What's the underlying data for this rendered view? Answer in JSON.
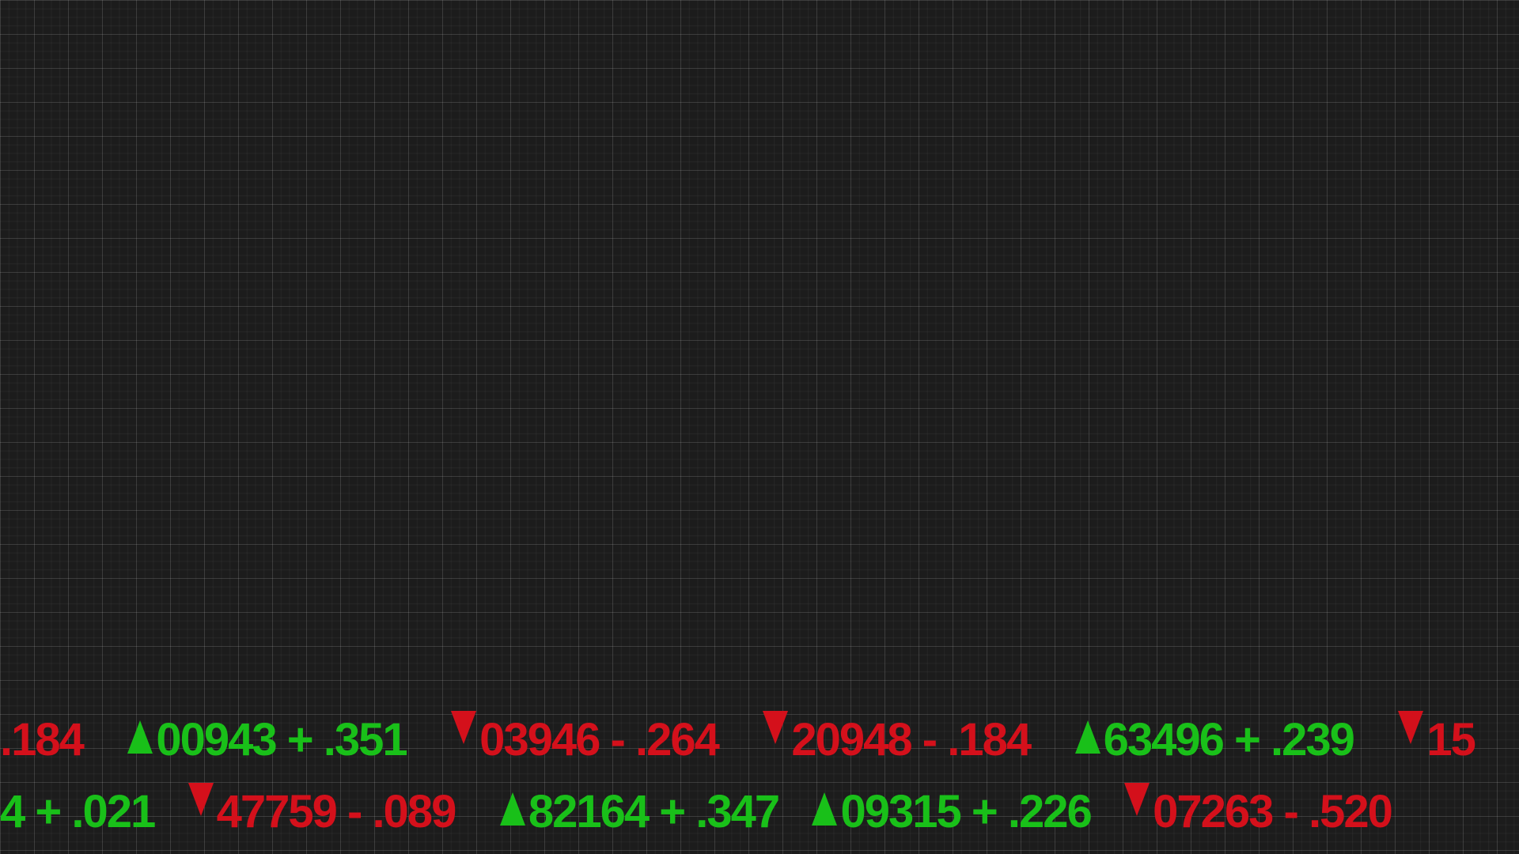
{
  "row1": {
    "lead": ".184",
    "t1": {
      "code": "00943",
      "change": "+ .351"
    },
    "t2": {
      "code": "03946",
      "change": "- .264"
    },
    "t3": {
      "code": "20948",
      "change": "- .184"
    },
    "t4": {
      "code": "63496",
      "change": "+ .239"
    },
    "tail": "15"
  },
  "row2": {
    "lead": "4 + .021",
    "t1": {
      "code": "47759",
      "change": "- .089"
    },
    "t2": {
      "code": "82164",
      "change": "+ .347"
    },
    "t3": {
      "code": "09315",
      "change": "+ .226"
    },
    "t4": {
      "code": "07263",
      "change": "- .520"
    }
  },
  "colors": {
    "up": "#19c019",
    "down": "#d4101b",
    "background": "#1c1c1c"
  },
  "icons": {
    "up": "triangle-up-icon",
    "down": "triangle-down-icon"
  }
}
